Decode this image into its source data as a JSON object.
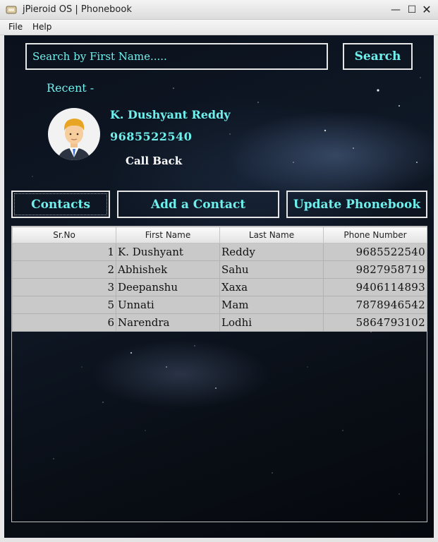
{
  "window": {
    "title": "jPieroid OS | Phonebook",
    "minimize": "—",
    "maximize": "☐",
    "close": "✕"
  },
  "menu": {
    "file": "File",
    "help": "Help"
  },
  "search": {
    "placeholder": "Search by First Name.....",
    "button": "Search"
  },
  "recent": {
    "label": "Recent -",
    "name": "K. Dushyant Reddy",
    "phone": "9685522540",
    "callback": "Call Back"
  },
  "nav": {
    "contacts": "Contacts",
    "add": "Add a Contact",
    "update": "Update Phonebook"
  },
  "table": {
    "headers": [
      "Sr.No",
      "First Name",
      "Last Name",
      "Phone Number"
    ],
    "rows": [
      [
        "1",
        "K. Dushyant",
        "Reddy",
        "9685522540"
      ],
      [
        "2",
        "Abhishek",
        "Sahu",
        "9827958719"
      ],
      [
        "3",
        "Deepanshu",
        "Xaxa",
        "9406114893"
      ],
      [
        "5",
        "Unnati",
        "Mam",
        "7878946542"
      ],
      [
        "6",
        "Narendra",
        "Lodhi",
        "5864793102"
      ]
    ]
  },
  "colors": {
    "accent": "#6ff0ec",
    "background": "#0b111c"
  }
}
